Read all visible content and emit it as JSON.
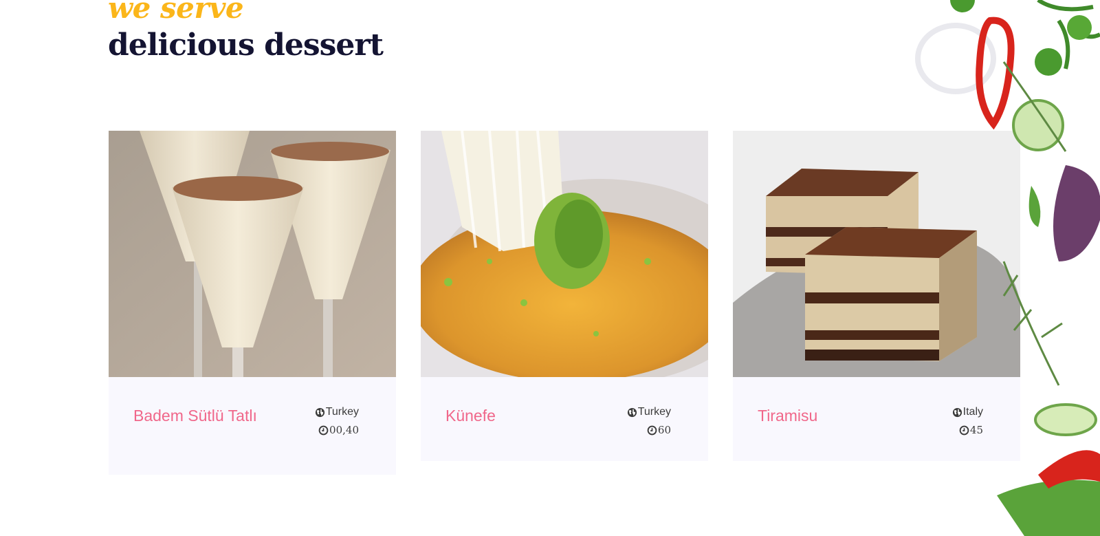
{
  "section": {
    "kicker": "we serve",
    "title": "delicious dessert"
  },
  "cards": [
    {
      "name": "Badem Sütlü Tatlı",
      "country": "Turkey",
      "time": "00,40"
    },
    {
      "name": "Künefe",
      "country": "Turkey",
      "time": "60"
    },
    {
      "name": "Tiramisu",
      "country": "Italy",
      "time": "45"
    }
  ],
  "icons": {
    "country": "globe-icon",
    "time": "clock-icon"
  },
  "colors": {
    "kicker": "#fbb61a",
    "title": "#141432",
    "dish_name": "#f0678a",
    "card_background": "#f9f8fe"
  }
}
